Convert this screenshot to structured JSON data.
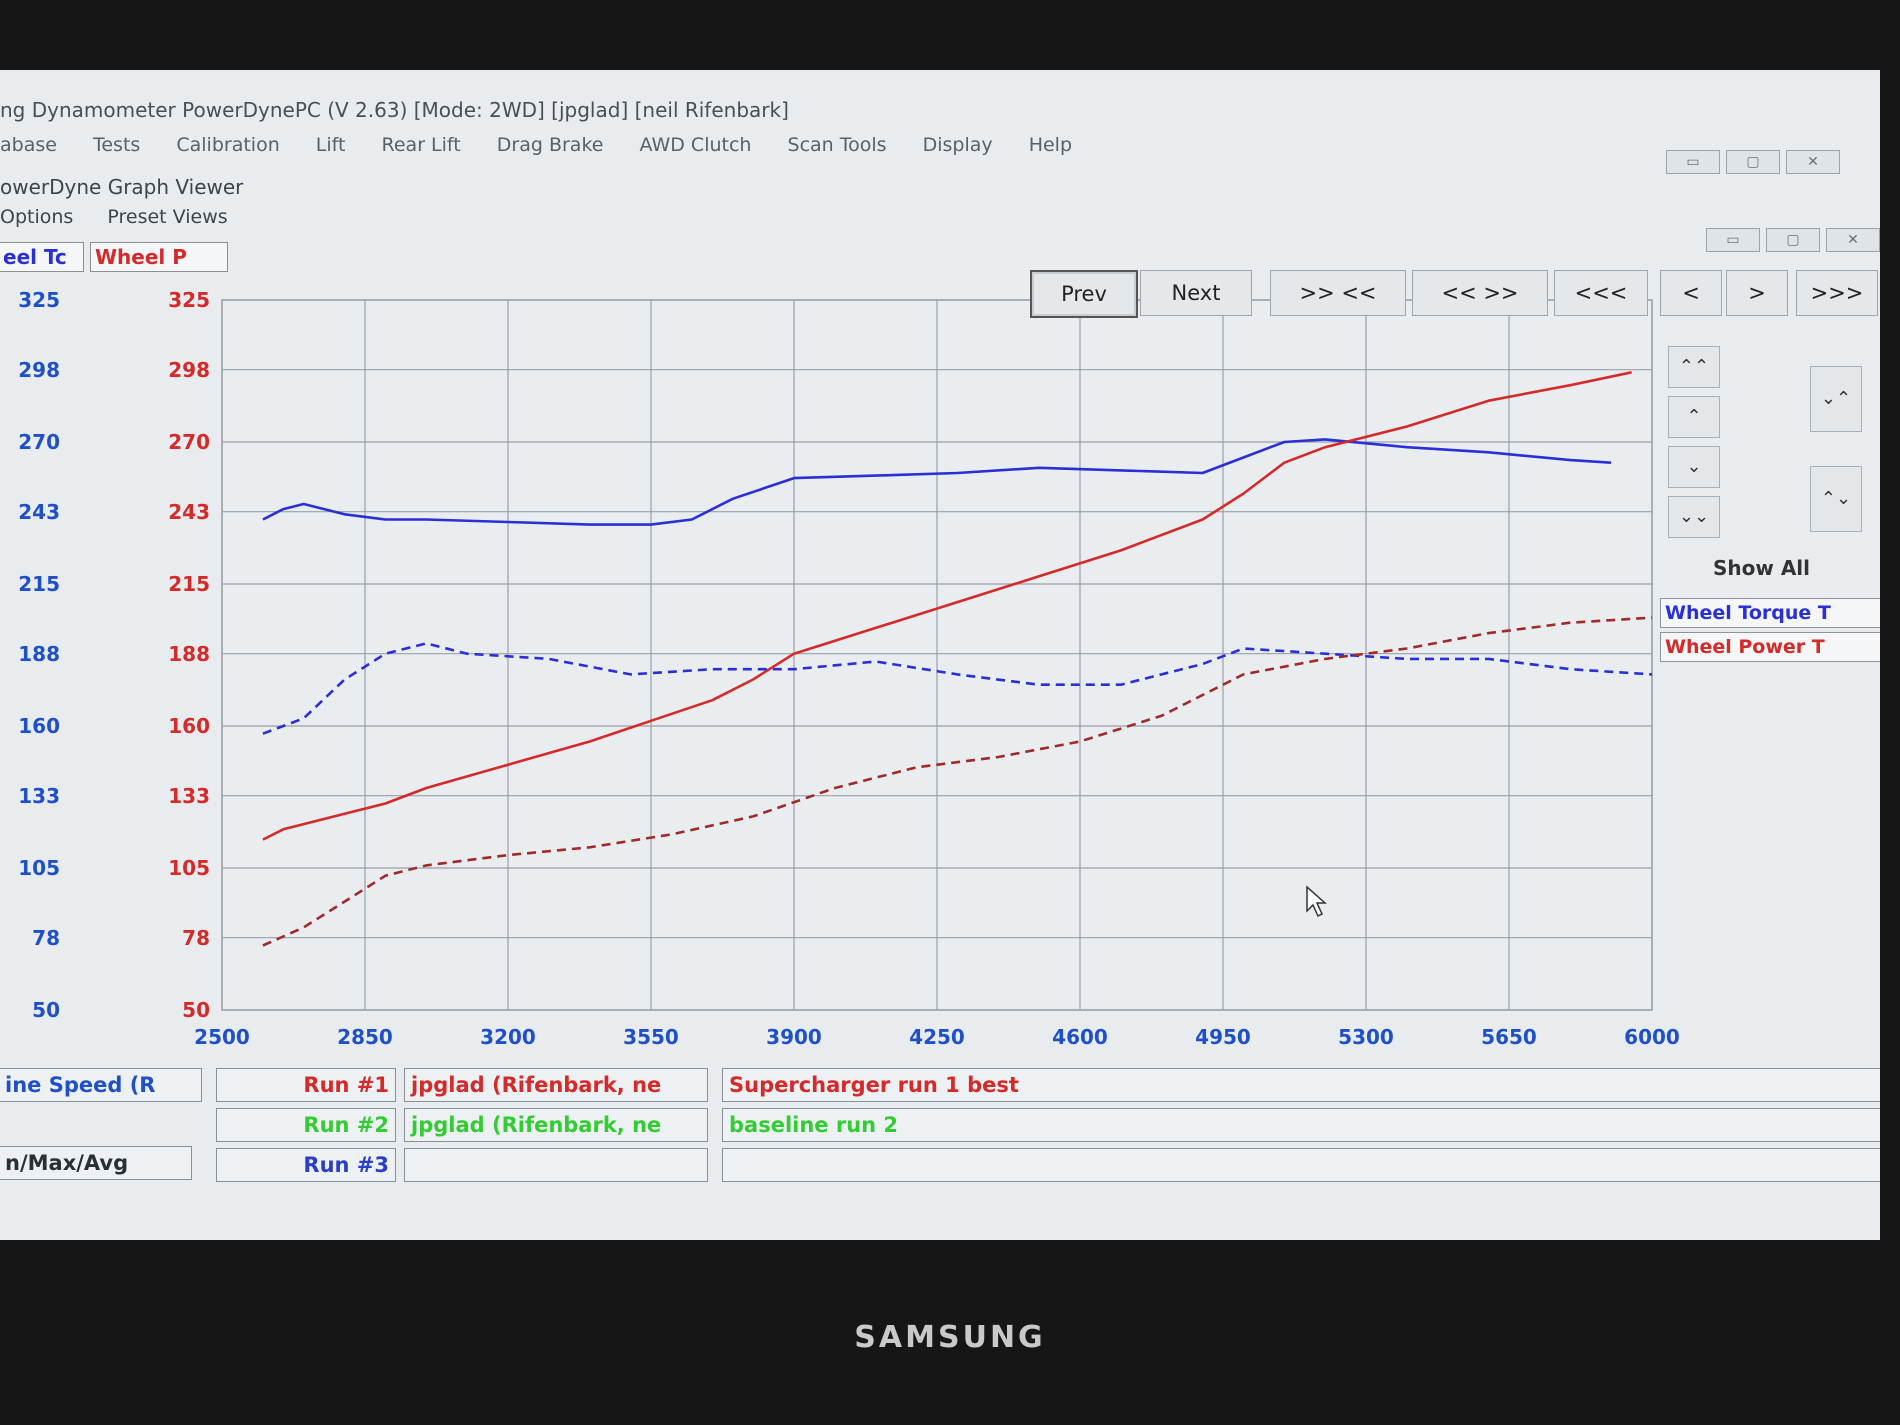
{
  "app": {
    "title": "ng Dynamometer PowerDynePC (V 2.63) [Mode: 2WD] [jpglad] [neil Rifenbark]",
    "menu": [
      "abase",
      "Tests",
      "Calibration",
      "Lift",
      "Rear Lift",
      "Drag Brake",
      "AWD Clutch",
      "Scan Tools",
      "Display",
      "Help"
    ],
    "window_buttons": [
      "▭",
      "▢",
      "✕"
    ]
  },
  "viewer": {
    "title": "owerDyne Graph Viewer",
    "menu": [
      "Options",
      "Preset Views"
    ],
    "axis_left_header": "eel Tc",
    "axis_right_header": "Wheel P",
    "nav_buttons": {
      "prev": "Prev",
      "next": "Next",
      "zoom_in": ">> <<",
      "zoom_out": "<< >>",
      "first": "<<<",
      "back": "<",
      "forward": ">",
      "last": ">>>"
    },
    "side_buttons": {
      "page_up": "⌃⌃",
      "up": "⌃",
      "down": "⌄",
      "page_down": "⌄⌄",
      "right_a": "⌄⌃",
      "right_b": "⌃⌄"
    },
    "show_all": "Show All",
    "legend": [
      "Wheel Torque T",
      "Wheel Power T"
    ],
    "colors": {
      "torque": "#2a2fd6",
      "power": "#d42a2a",
      "tick_blue": "#2050c8",
      "run2_green": "#33cc33",
      "run3_blue": "#2a3fc8"
    }
  },
  "bottom": {
    "x_axis_label": "ine Speed (R",
    "minmaxavg": "n/Max/Avg",
    "runs": [
      {
        "label": "Run #1",
        "operator": "jpglad (Rifenbark, ne",
        "description": "Supercharger run 1 best"
      },
      {
        "label": "Run #2",
        "operator": "jpglad (Rifenbark, ne",
        "description": "baseline run 2"
      },
      {
        "label": "Run #3",
        "operator": "",
        "description": ""
      }
    ]
  },
  "monitor": {
    "brand": "SAMSUNG"
  },
  "chart_data": {
    "type": "line",
    "xlabel": "ine Speed (R",
    "x_ticks": [
      2500,
      2850,
      3200,
      3550,
      3900,
      4250,
      4600,
      4950,
      5300,
      5650,
      6000
    ],
    "y_ticks_left": [
      325,
      298,
      270,
      243,
      215,
      188,
      160,
      133,
      105,
      78,
      50
    ],
    "y_ticks_right": [
      325,
      298,
      270,
      243,
      215,
      188,
      160,
      133,
      105,
      78,
      50
    ],
    "xlim": [
      2500,
      6000
    ],
    "ylim": [
      50,
      325
    ],
    "grid": true,
    "series": [
      {
        "name": "Wheel Torque T",
        "run": "Run #1",
        "style": "solid",
        "color": "#2a2fd6",
        "x": [
          2600,
          2650,
          2700,
          2800,
          2900,
          3000,
          3200,
          3400,
          3550,
          3650,
          3750,
          3900,
          4100,
          4300,
          4500,
          4700,
          4900,
          5000,
          5100,
          5200,
          5400,
          5600,
          5800,
          5900
        ],
        "y": [
          240,
          244,
          246,
          242,
          240,
          240,
          239,
          238,
          238,
          240,
          248,
          256,
          257,
          258,
          260,
          259,
          258,
          264,
          270,
          271,
          268,
          266,
          263,
          262
        ]
      },
      {
        "name": "Wheel Power T",
        "run": "Run #1",
        "style": "solid",
        "color": "#d42a2a",
        "x": [
          2600,
          2650,
          2700,
          2800,
          2900,
          3000,
          3200,
          3400,
          3550,
          3700,
          3800,
          3900,
          4100,
          4300,
          4500,
          4700,
          4900,
          5000,
          5100,
          5200,
          5400,
          5600,
          5800,
          5950
        ],
        "y": [
          116,
          120,
          122,
          126,
          130,
          136,
          145,
          154,
          162,
          170,
          178,
          188,
          198,
          208,
          218,
          228,
          240,
          250,
          262,
          268,
          276,
          286,
          292,
          297
        ]
      },
      {
        "name": "Wheel Torque T",
        "run": "Run #2",
        "style": "dashed",
        "color": "#2a2fd6",
        "x": [
          2600,
          2700,
          2800,
          2900,
          3000,
          3100,
          3300,
          3500,
          3700,
          3900,
          4100,
          4300,
          4500,
          4700,
          4900,
          5000,
          5200,
          5400,
          5600,
          5800,
          6000
        ],
        "y": [
          157,
          163,
          178,
          188,
          192,
          188,
          186,
          180,
          182,
          182,
          185,
          180,
          176,
          176,
          184,
          190,
          188,
          186,
          186,
          182,
          180
        ]
      },
      {
        "name": "Wheel Power T",
        "run": "Run #2",
        "style": "dashed",
        "color": "#a02a2a",
        "x": [
          2600,
          2700,
          2800,
          2900,
          3000,
          3200,
          3400,
          3600,
          3800,
          4000,
          4200,
          4400,
          4600,
          4800,
          5000,
          5200,
          5400,
          5600,
          5800,
          6000
        ],
        "y": [
          75,
          82,
          92,
          102,
          106,
          110,
          113,
          118,
          125,
          136,
          144,
          148,
          154,
          164,
          180,
          186,
          190,
          196,
          200,
          202
        ]
      }
    ]
  }
}
